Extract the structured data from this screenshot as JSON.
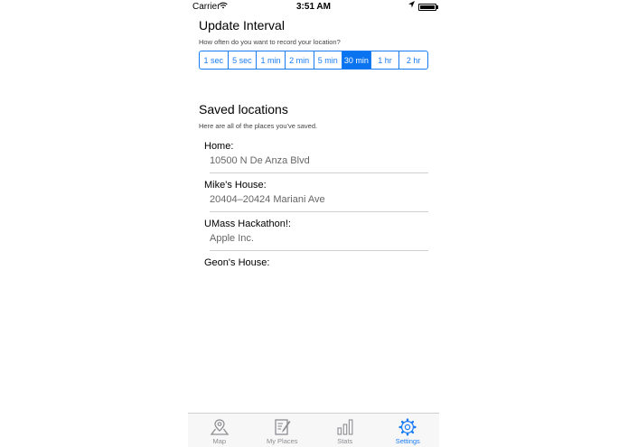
{
  "status_bar": {
    "carrier": "Carrier",
    "time": "3:51 AM"
  },
  "interval": {
    "title": "Update Interval",
    "subtitle": "How often do you want to record your location?",
    "options": [
      "1 sec",
      "5 sec",
      "1 min",
      "2 min",
      "5 min",
      "30 min",
      "1 hr",
      "2 hr"
    ],
    "selected": "30 min"
  },
  "saved": {
    "title": "Saved locations",
    "subtitle": "Here are all of the places you've saved.",
    "places": [
      {
        "name": "Home:",
        "address": "10500 N De Anza Blvd"
      },
      {
        "name": "Mike's House:",
        "address": "20404–20424 Mariani Ave"
      },
      {
        "name": "UMass Hackathon!:",
        "address": "Apple Inc."
      },
      {
        "name": "Geon's House:",
        "address": ""
      }
    ]
  },
  "tabbar": {
    "tabs": [
      {
        "label": "Map",
        "icon": "map-pin-icon"
      },
      {
        "label": "My Places",
        "icon": "notepad-icon"
      },
      {
        "label": "Stats",
        "icon": "bar-chart-icon"
      },
      {
        "label": "Settings",
        "icon": "gear-icon"
      }
    ],
    "active": "Settings"
  },
  "colors": {
    "accent": "#0a74f0",
    "tab_inactive": "#8e8e93"
  }
}
